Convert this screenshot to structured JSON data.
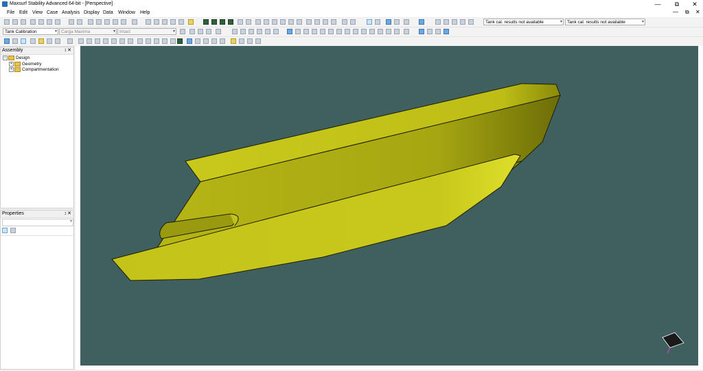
{
  "window": {
    "title": "Maxsurf Stability Advanced 64-bit - [Perspective]",
    "minimize": "—",
    "restore": "⧉",
    "close": "✕"
  },
  "menu": {
    "items": [
      "File",
      "Edit",
      "View",
      "Case",
      "Analysis",
      "Display",
      "Data",
      "Window",
      "Help"
    ],
    "mdi_minimize": "—",
    "mdi_restore": "⧉",
    "mdi_close": "✕"
  },
  "toolbar2": {
    "calibration": "Tank Calibration",
    "loadcase": "Carga Maxima",
    "damage": "Intact",
    "tank_result_1": "Tank cal. results not available",
    "tank_result_2": "Tank cal. results not available"
  },
  "assembly": {
    "title": "Assembly",
    "pin": "↕",
    "close": "✕",
    "root": "Design",
    "children": [
      "Geometry",
      "Compartmentation"
    ]
  },
  "properties": {
    "title": "Properties",
    "pin": "↕",
    "close": "✕"
  },
  "colors": {
    "viewport_bg": "#405f5f",
    "hull_light": "#c8c81e",
    "hull_dark": "#7a7a0a"
  }
}
